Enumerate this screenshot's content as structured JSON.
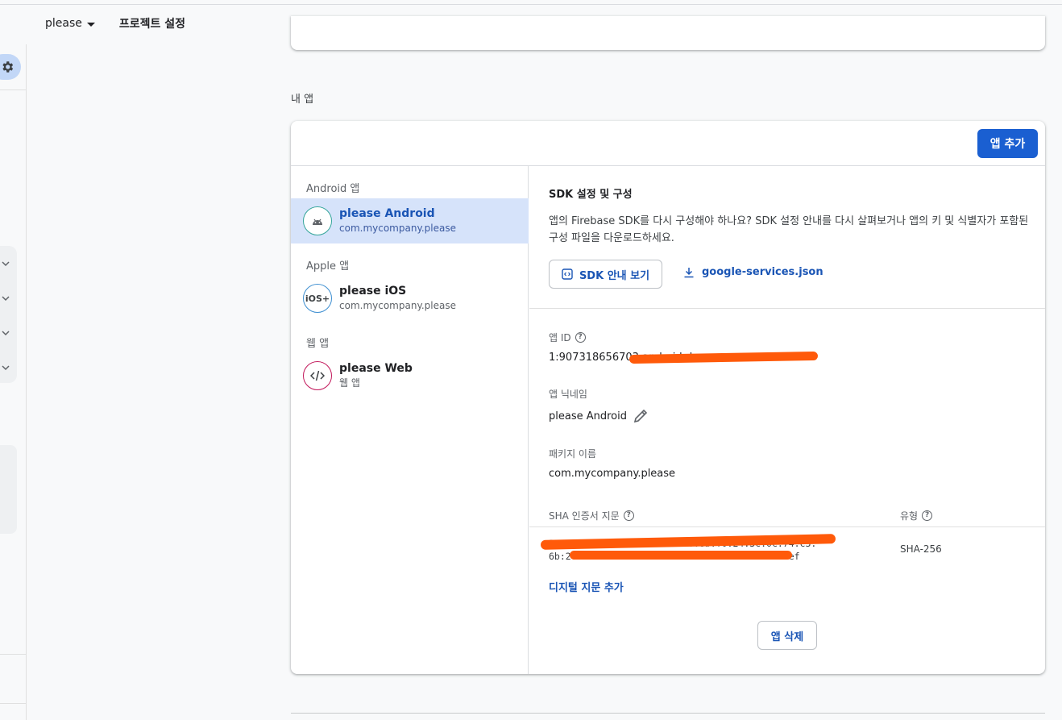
{
  "header": {
    "project_name": "please",
    "page_tab": "프로젝트 설정"
  },
  "section": {
    "title": "내 앱"
  },
  "toolbar": {
    "add_app_label": "앱 추가"
  },
  "app_groups": [
    {
      "label": "Android 앱",
      "app": {
        "name": "please Android",
        "sub": "com.mycompany.please",
        "icon": "android-icon",
        "selected": true
      }
    },
    {
      "label": "Apple 앱",
      "app": {
        "name": "please iOS",
        "sub": "com.mycompany.please",
        "icon": "ios-icon",
        "icon_text": "iOS+"
      }
    },
    {
      "label": "웹 앱",
      "app": {
        "name": "please Web",
        "sub": "웹 앱",
        "icon": "code-icon"
      }
    }
  ],
  "sdk": {
    "title": "SDK 설정 및 구성",
    "description": "앱의 Firebase SDK를 다시 구성해야 하나요? SDK 설정 안내를 다시 살펴보거나 앱의 키 및 식별자가 포함된 구성 파일을 다운로드하세요.",
    "guide_button": "SDK 안내 보기",
    "config_file_link": "google-services.json"
  },
  "details": {
    "app_id_label": "앱 ID",
    "app_id_value": "1:907318656703:android:d",
    "nickname_label": "앱 닉네임",
    "nickname_value": "please Android",
    "package_label": "패키지 이름",
    "package_value": "com.mycompany.please"
  },
  "sha": {
    "fingerprint_label": "SHA 인증서 지문",
    "type_label": "유형",
    "fingerprint_line1": "27:1d:0c:c0:75:d5:0e:f3:b0:8b:f0:24:3c:0c:74:c3:",
    "fingerprint_line2": "6b:2f:0a:20:5d:b5:8e:d5:34:44:1e:96:2c:16e:ef",
    "type_value": "SHA-256",
    "add_fingerprint_link": "디지털 지문 추가"
  },
  "delete_button": "앱 삭제",
  "colors": {
    "primary": "#1a5fd1",
    "selected_bg": "#d6e3fa",
    "redaction": "#ff5a0a"
  }
}
